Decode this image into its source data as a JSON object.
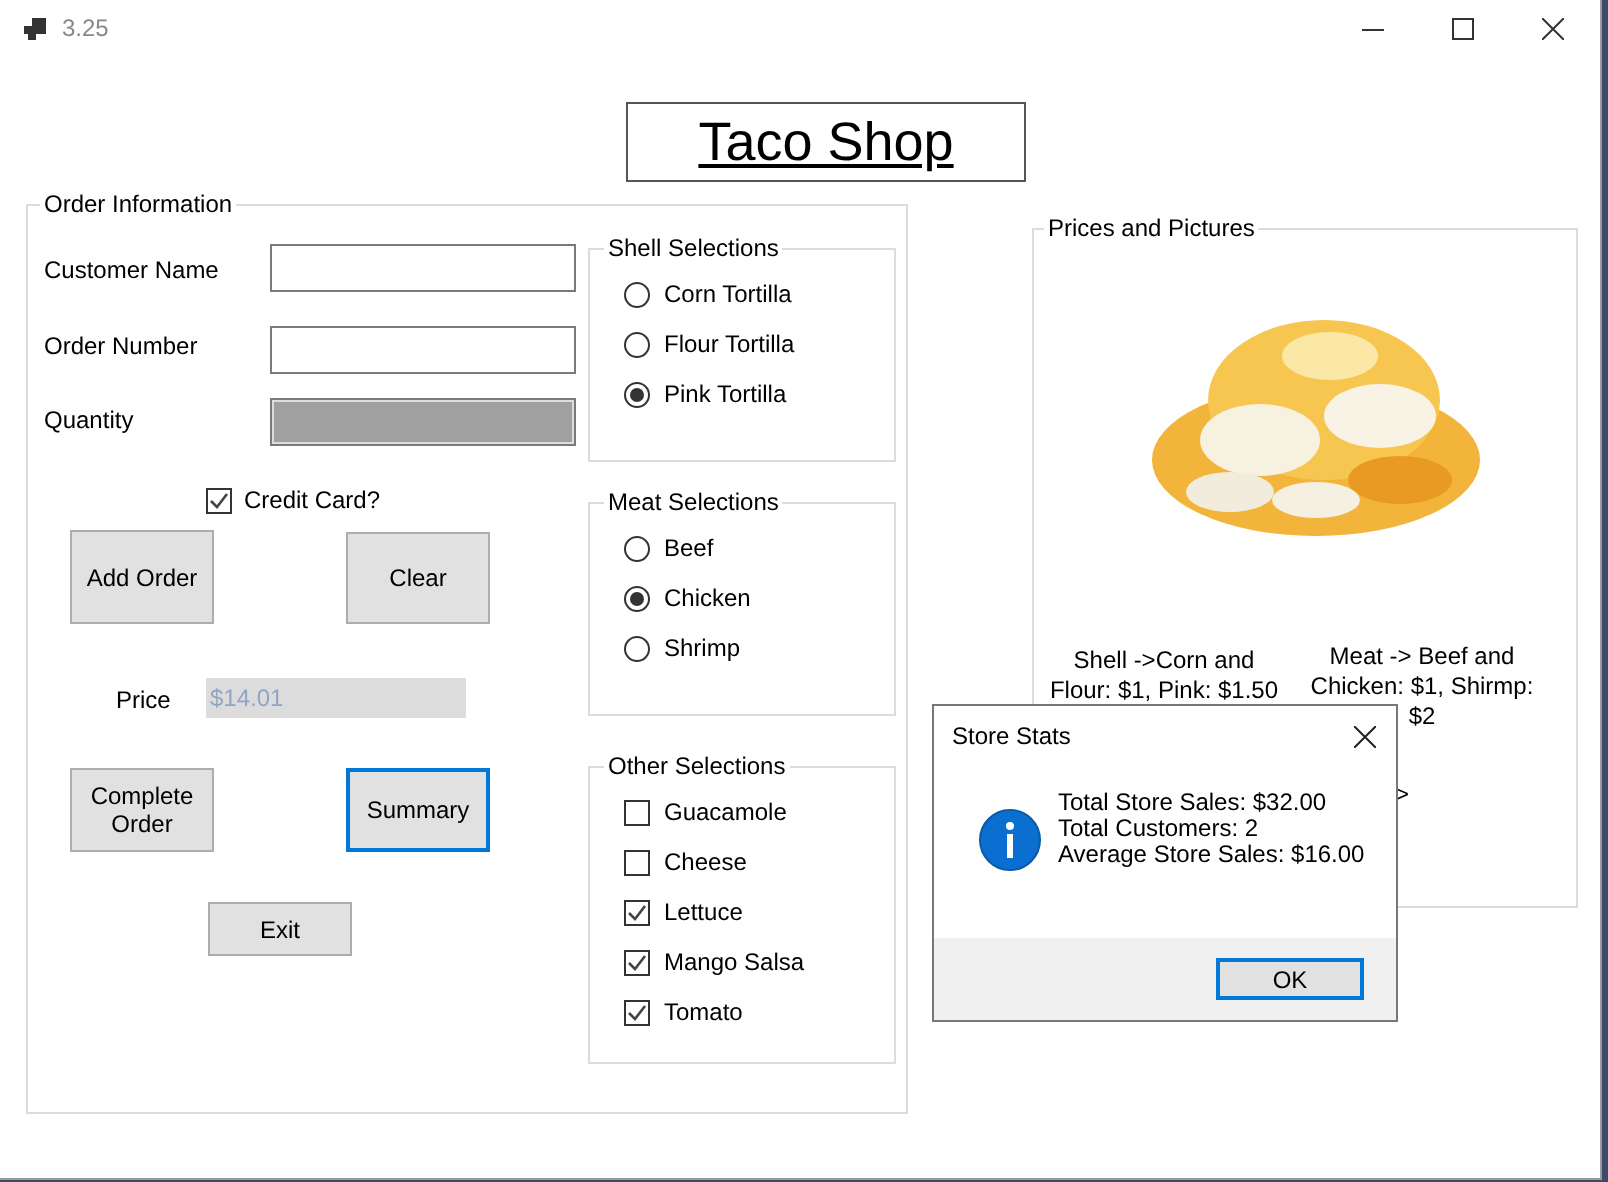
{
  "window": {
    "title": "3.25"
  },
  "heading": "Taco Shop",
  "order_information": {
    "title": "Order Information",
    "fields": [
      {
        "label": "Customer Name",
        "disabled": false
      },
      {
        "label": "Order Number",
        "disabled": false
      },
      {
        "label": "Quantity",
        "disabled": true
      }
    ],
    "credit_card": {
      "label": "Credit Card?",
      "checked": true
    },
    "buttons": [
      {
        "label": "Add Order",
        "focused": false
      },
      {
        "label": "Clear",
        "focused": false
      },
      {
        "label": "Complete Order",
        "focused": false
      },
      {
        "label": "Summary",
        "focused": true
      },
      {
        "label": "Exit",
        "focused": false
      }
    ],
    "price": {
      "label": "Price",
      "value": "$14.01"
    }
  },
  "shell_selections": {
    "title": "Shell Selections",
    "options": [
      {
        "label": "Corn Tortilla",
        "selected": false
      },
      {
        "label": "Flour Tortilla",
        "selected": false
      },
      {
        "label": "Pink Tortilla",
        "selected": true
      }
    ]
  },
  "meat_selections": {
    "title": "Meat Selections",
    "options": [
      {
        "label": "Beef",
        "selected": false
      },
      {
        "label": "Chicken",
        "selected": true
      },
      {
        "label": "Shrimp",
        "selected": false
      }
    ]
  },
  "other_selections": {
    "title": "Other Selections",
    "options": [
      {
        "label": "Guacamole",
        "checked": false
      },
      {
        "label": "Cheese",
        "checked": false
      },
      {
        "label": "Lettuce",
        "checked": true
      },
      {
        "label": "Mango Salsa",
        "checked": true
      },
      {
        "label": "Tomato",
        "checked": true
      }
    ]
  },
  "prices_and_pictures": {
    "title": "Prices and Pictures",
    "notes": [
      "Shell ->Corn and Flour: $1, Pink: $1.50",
      "Meat -> Beef and Chicken: $1, Shirmp: $2",
      ">"
    ]
  },
  "dialog": {
    "title": "Store Stats",
    "lines": [
      "Total Store Sales: $32.00",
      "Total Customers: 2",
      "Average Store Sales: $16.00"
    ],
    "button": "OK"
  }
}
